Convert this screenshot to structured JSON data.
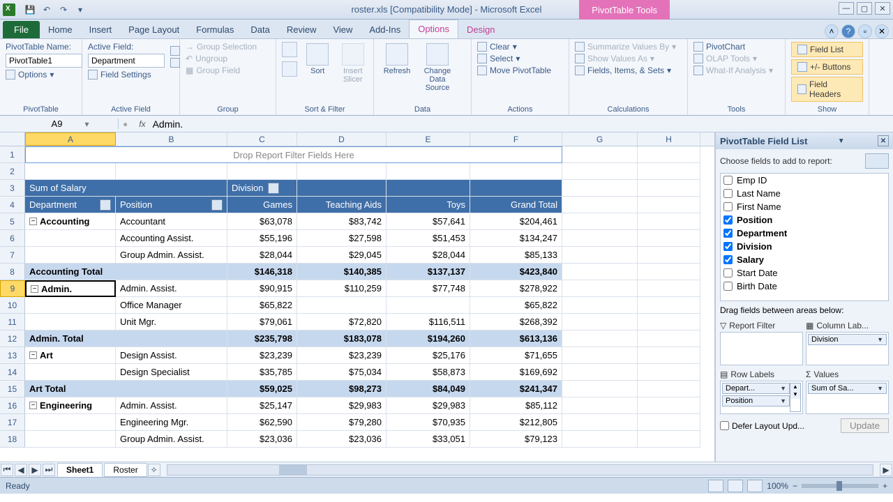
{
  "title": "roster.xls  [Compatibility Mode] - Microsoft Excel",
  "pivot_tools_label": "PivotTable Tools",
  "tabs": {
    "file": "File",
    "home": "Home",
    "insert": "Insert",
    "pagelayout": "Page Layout",
    "formulas": "Formulas",
    "data": "Data",
    "review": "Review",
    "view": "View",
    "addins": "Add-Ins",
    "options": "Options",
    "design": "Design"
  },
  "ribbon": {
    "pt_name_label": "PivotTable Name:",
    "pt_name": "PivotTable1",
    "options": "Options",
    "active_field_label": "Active Field:",
    "active_field": "Department",
    "field_settings": "Field Settings",
    "group_selection": "Group Selection",
    "ungroup": "Ungroup",
    "group_field": "Group Field",
    "sort": "Sort",
    "insert_slicer": "Insert Slicer",
    "refresh": "Refresh",
    "change_source": "Change Data Source",
    "clear": "Clear",
    "select": "Select",
    "move": "Move PivotTable",
    "summarize": "Summarize Values By",
    "show_as": "Show Values As",
    "fields_items": "Fields, Items, & Sets",
    "pivotchart": "PivotChart",
    "olap": "OLAP Tools",
    "whatif": "What-If Analysis",
    "field_list": "Field List",
    "pm_buttons": "+/- Buttons",
    "field_headers": "Field Headers",
    "grp_pivottable": "PivotTable",
    "grp_activefield": "Active Field",
    "grp_group": "Group",
    "grp_sortfilter": "Sort & Filter",
    "grp_data": "Data",
    "grp_actions": "Actions",
    "grp_calc": "Calculations",
    "grp_tools": "Tools",
    "grp_show": "Show"
  },
  "namebox": "A9",
  "formula": "Admin.",
  "columns": [
    "A",
    "B",
    "C",
    "D",
    "E",
    "F",
    "G",
    "H"
  ],
  "filter_placeholder": "Drop Report Filter Fields Here",
  "headers": {
    "sum": "Sum of Salary",
    "division": "Division",
    "department": "Department",
    "position": "Position",
    "games": "Games",
    "teaching": "Teaching Aids",
    "toys": "Toys",
    "grand": "Grand Total"
  },
  "rows": [
    {
      "n": 5,
      "a": "Accounting",
      "b": "Accountant",
      "c": "$63,078",
      "d": "$83,742",
      "e": "$57,641",
      "f": "$204,461",
      "exp": true
    },
    {
      "n": 6,
      "a": "",
      "b": "Accounting Assist.",
      "c": "$55,196",
      "d": "$27,598",
      "e": "$51,453",
      "f": "$134,247"
    },
    {
      "n": 7,
      "a": "",
      "b": "Group Admin. Assist.",
      "c": "$28,044",
      "d": "$29,045",
      "e": "$28,044",
      "f": "$85,133"
    },
    {
      "n": 8,
      "sub": true,
      "a": "Accounting Total",
      "c": "$146,318",
      "d": "$140,385",
      "e": "$137,137",
      "f": "$423,840"
    },
    {
      "n": 9,
      "sel": true,
      "a": "Admin.",
      "b": "Admin. Assist.",
      "c": "$90,915",
      "d": "$110,259",
      "e": "$77,748",
      "f": "$278,922",
      "exp": true
    },
    {
      "n": 10,
      "a": "",
      "b": "Office Manager",
      "c": "$65,822",
      "d": "",
      "e": "",
      "f": "$65,822"
    },
    {
      "n": 11,
      "a": "",
      "b": "Unit Mgr.",
      "c": "$79,061",
      "d": "$72,820",
      "e": "$116,511",
      "f": "$268,392"
    },
    {
      "n": 12,
      "sub": true,
      "a": "Admin. Total",
      "c": "$235,798",
      "d": "$183,078",
      "e": "$194,260",
      "f": "$613,136"
    },
    {
      "n": 13,
      "a": "Art",
      "b": "Design Assist.",
      "c": "$23,239",
      "d": "$23,239",
      "e": "$25,176",
      "f": "$71,655",
      "exp": true
    },
    {
      "n": 14,
      "a": "",
      "b": "Design Specialist",
      "c": "$35,785",
      "d": "$75,034",
      "e": "$58,873",
      "f": "$169,692"
    },
    {
      "n": 15,
      "sub": true,
      "a": "Art Total",
      "c": "$59,025",
      "d": "$98,273",
      "e": "$84,049",
      "f": "$241,347"
    },
    {
      "n": 16,
      "a": "Engineering",
      "b": "Admin. Assist.",
      "c": "$25,147",
      "d": "$29,983",
      "e": "$29,983",
      "f": "$85,112",
      "exp": true
    },
    {
      "n": 17,
      "a": "",
      "b": "Engineering Mgr.",
      "c": "$62,590",
      "d": "$79,280",
      "e": "$70,935",
      "f": "$212,805"
    },
    {
      "n": 18,
      "a": "",
      "b": "Group Admin. Assist.",
      "c": "$23,036",
      "d": "$23,036",
      "e": "$33,051",
      "f": "$79,123"
    }
  ],
  "fieldlist": {
    "title": "PivotTable Field List",
    "choose": "Choose fields to add to report:",
    "fields": [
      {
        "name": "Emp ID",
        "c": false
      },
      {
        "name": "Last Name",
        "c": false
      },
      {
        "name": "First Name",
        "c": false
      },
      {
        "name": "Position",
        "c": true
      },
      {
        "name": "Department",
        "c": true
      },
      {
        "name": "Division",
        "c": true
      },
      {
        "name": "Salary",
        "c": true
      },
      {
        "name": "Start Date",
        "c": false
      },
      {
        "name": "Birth Date",
        "c": false
      }
    ],
    "drag": "Drag fields between areas below:",
    "report_filter": "Report Filter",
    "column_labels": "Column Lab...",
    "row_labels": "Row Labels",
    "values": "Values",
    "col_pill": "Division",
    "row_pill1": "Depart...",
    "row_pill2": "Position",
    "val_pill": "Sum of Sa...",
    "defer": "Defer Layout Upd...",
    "update": "Update"
  },
  "sheets": {
    "s1": "Sheet1",
    "s2": "Roster"
  },
  "status": {
    "ready": "Ready",
    "zoom": "100%"
  }
}
